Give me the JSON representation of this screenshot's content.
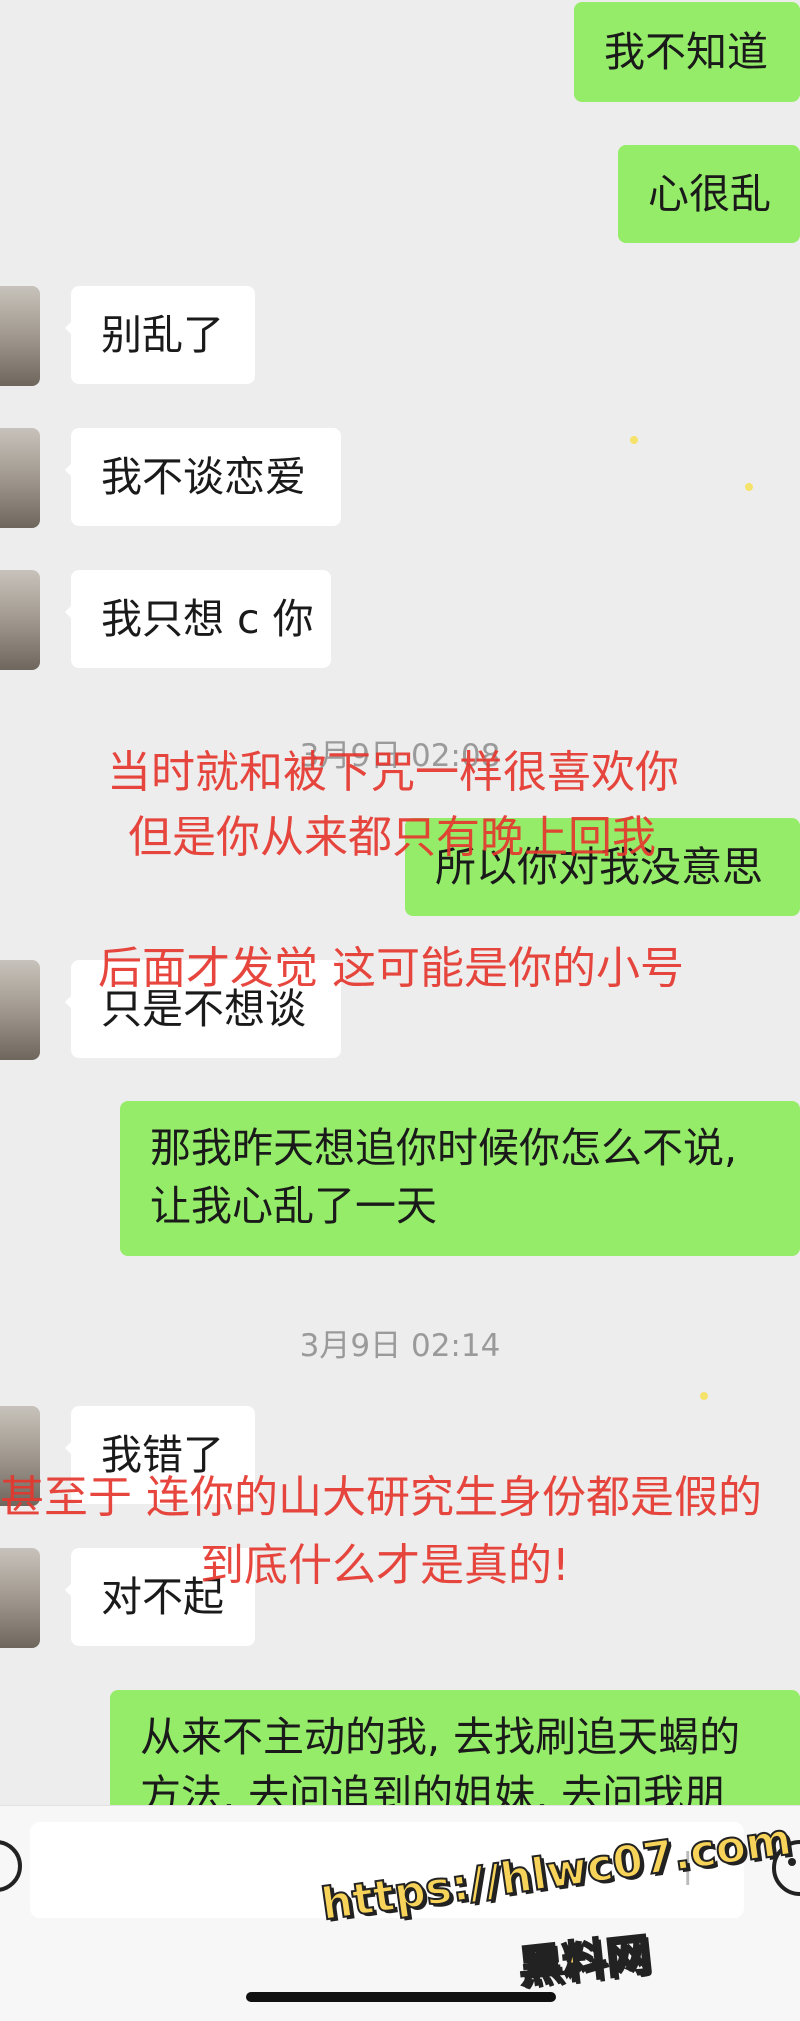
{
  "messages": {
    "m1": "我不知道",
    "m2": "心很乱",
    "m3": "别乱了",
    "m4": "我不谈恋爱",
    "m5": "我只想 c 你",
    "ts1": "3月9日 02:08",
    "m6": "所以你对我没意思",
    "m7": "只是不想谈",
    "m8_line1": "那我昨天想追你时候你怎么不说,",
    "m8_line2": "让我心乱了一天",
    "ts2": "3月9日 02:14",
    "m9": "我错了",
    "m10": "对不起",
    "m11_line1": "从来不主动的我, 去找刷追天蝎的",
    "m11_line2": "方法, 去问追到的姐妹, 去问我朋"
  },
  "overlay_text": {
    "o1": "当时就和被下咒一样很喜欢你",
    "o2": "但是你从来都只有晚上回我",
    "o3": "后面才发觉 这可能是你的小号",
    "o4": "甚至于 连你的山大研究生身份都是假的",
    "o5": "到底什么才是真的!"
  },
  "watermark": {
    "url": "https://hlwc07.com",
    "site": "黑料网"
  },
  "colors": {
    "outgoing_bubble": "#95ec69",
    "incoming_bubble": "#ffffff",
    "background": "#ededed",
    "overlay_red": "#e5372e",
    "watermark_yellow": "#f7d35a"
  },
  "icons": [
    "voice-icon",
    "emoji-icon"
  ]
}
